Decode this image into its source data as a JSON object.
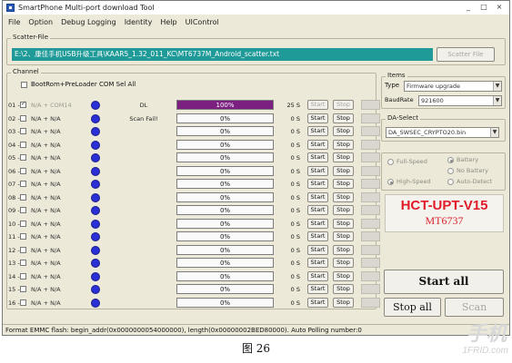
{
  "app": {
    "title": "SmartPhone Multi-port download Tool",
    "window_controls": [
      "_",
      "□",
      "×"
    ]
  },
  "menu": [
    "File",
    "Option",
    "Debug Logging",
    "Identity",
    "Help",
    "UIControl"
  ],
  "scatter": {
    "group_label": "Scatter-File",
    "path": "E:\\2、康佳手机USB升级工具\\KAAR5_1.32_011_KC\\MT6737M_Android_scatter.txt",
    "button_label": "Scatter File"
  },
  "channel": {
    "group_label": "Channel",
    "select_all_label": "BootRom+PreLoader COM Sel All",
    "rows": [
      {
        "num": "01 -",
        "checked": true,
        "port": "N/A + COM14",
        "port_dim": true,
        "status": "DL",
        "progress": 100,
        "progress_text": "100%",
        "time": "25 S",
        "start": "Start",
        "stop": "Stop",
        "start_disabled": true,
        "stop_disabled": true
      },
      {
        "num": "02 -",
        "checked": false,
        "port": "N/A + N/A",
        "port_dim": false,
        "status": "Scan Fail!",
        "progress": 0,
        "progress_text": "0%",
        "time": "0 S",
        "start": "Start",
        "stop": "Stop",
        "start_disabled": false,
        "stop_disabled": false
      },
      {
        "num": "03 -",
        "checked": false,
        "port": "N/A + N/A",
        "port_dim": false,
        "status": "",
        "progress": 0,
        "progress_text": "0%",
        "time": "0 S",
        "start": "Start",
        "stop": "Stop",
        "start_disabled": false,
        "stop_disabled": false
      },
      {
        "num": "04 -",
        "checked": false,
        "port": "N/A + N/A",
        "port_dim": false,
        "status": "",
        "progress": 0,
        "progress_text": "0%",
        "time": "0 S",
        "start": "Start",
        "stop": "Stop",
        "start_disabled": false,
        "stop_disabled": false
      },
      {
        "num": "05 -",
        "checked": false,
        "port": "N/A + N/A",
        "port_dim": false,
        "status": "",
        "progress": 0,
        "progress_text": "0%",
        "time": "0 S",
        "start": "Start",
        "stop": "Stop",
        "start_disabled": false,
        "stop_disabled": false
      },
      {
        "num": "06 -",
        "checked": false,
        "port": "N/A + N/A",
        "port_dim": false,
        "status": "",
        "progress": 0,
        "progress_text": "0%",
        "time": "0 S",
        "start": "Start",
        "stop": "Stop",
        "start_disabled": false,
        "stop_disabled": false
      },
      {
        "num": "07 -",
        "checked": false,
        "port": "N/A + N/A",
        "port_dim": false,
        "status": "",
        "progress": 0,
        "progress_text": "0%",
        "time": "0 S",
        "start": "Start",
        "stop": "Stop",
        "start_disabled": false,
        "stop_disabled": false
      },
      {
        "num": "08 -",
        "checked": false,
        "port": "N/A + N/A",
        "port_dim": false,
        "status": "",
        "progress": 0,
        "progress_text": "0%",
        "time": "0 S",
        "start": "Start",
        "stop": "Stop",
        "start_disabled": false,
        "stop_disabled": false
      },
      {
        "num": "09 -",
        "checked": false,
        "port": "N/A + N/A",
        "port_dim": false,
        "status": "",
        "progress": 0,
        "progress_text": "0%",
        "time": "0 S",
        "start": "Start",
        "stop": "Stop",
        "start_disabled": false,
        "stop_disabled": false
      },
      {
        "num": "10 -",
        "checked": false,
        "port": "N/A + N/A",
        "port_dim": false,
        "status": "",
        "progress": 0,
        "progress_text": "0%",
        "time": "0 S",
        "start": "Start",
        "stop": "Stop",
        "start_disabled": false,
        "stop_disabled": false
      },
      {
        "num": "11 -",
        "checked": false,
        "port": "N/A + N/A",
        "port_dim": false,
        "status": "",
        "progress": 0,
        "progress_text": "0%",
        "time": "0 S",
        "start": "Start",
        "stop": "Stop",
        "start_disabled": false,
        "stop_disabled": false
      },
      {
        "num": "12 -",
        "checked": false,
        "port": "N/A + N/A",
        "port_dim": false,
        "status": "",
        "progress": 0,
        "progress_text": "0%",
        "time": "0 S",
        "start": "Start",
        "stop": "Stop",
        "start_disabled": false,
        "stop_disabled": false
      },
      {
        "num": "13 -",
        "checked": false,
        "port": "N/A + N/A",
        "port_dim": false,
        "status": "",
        "progress": 0,
        "progress_text": "0%",
        "time": "0 S",
        "start": "Start",
        "stop": "Stop",
        "start_disabled": false,
        "stop_disabled": false
      },
      {
        "num": "14 -",
        "checked": false,
        "port": "N/A + N/A",
        "port_dim": false,
        "status": "",
        "progress": 0,
        "progress_text": "0%",
        "time": "0 S",
        "start": "Start",
        "stop": "Stop",
        "start_disabled": false,
        "stop_disabled": false
      },
      {
        "num": "15 -",
        "checked": false,
        "port": "N/A + N/A",
        "port_dim": false,
        "status": "",
        "progress": 0,
        "progress_text": "0%",
        "time": "0 S",
        "start": "Start",
        "stop": "Stop",
        "start_disabled": false,
        "stop_disabled": false
      },
      {
        "num": "16 -",
        "checked": false,
        "port": "N/A + N/A",
        "port_dim": false,
        "status": "",
        "progress": 0,
        "progress_text": "0%",
        "time": "0 S",
        "start": "Start",
        "stop": "Stop",
        "start_disabled": false,
        "stop_disabled": false
      }
    ]
  },
  "items": {
    "group_label": "Items",
    "type_label": "Type",
    "type_value": "Firmware upgrade",
    "baud_label": "BaudRate",
    "baud_value": "921600"
  },
  "da": {
    "group_label": "DA-Select",
    "value": "DA_SWSEC_CRYPTO20.bin"
  },
  "speed": {
    "full_speed": "Full-Speed",
    "high_speed": "High-Speed",
    "battery": "Battery",
    "no_battery": "No Battery",
    "auto_detect": "Auto-Detect"
  },
  "brand": {
    "line1": "HCT-UPT-V15",
    "line2": "MT6737",
    "color": "#e11b2a"
  },
  "actions": {
    "start_all": "Start all",
    "stop_all": "Stop all",
    "scan": "Scan"
  },
  "statusbar": "Format EMMC flash:  begin_addr(0x0000000054000000), length(0x00000002BED80000). Auto Polling number:0",
  "caption": "图 26",
  "watermark": {
    "main": "手机",
    "sub": "1FRID.com"
  }
}
